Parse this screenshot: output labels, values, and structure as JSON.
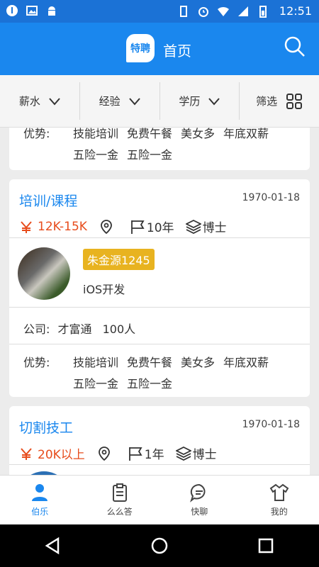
{
  "status_bar": {
    "time": "12:51"
  },
  "app_bar": {
    "logo_text": "特聘",
    "title": "首页"
  },
  "filters": [
    {
      "label": "薪水"
    },
    {
      "label": "经验"
    },
    {
      "label": "学历"
    },
    {
      "label": "筛选"
    }
  ],
  "partial_card": {
    "adv_label": "优势:",
    "adv_values": [
      "技能培训",
      "免费午餐",
      "美女多",
      "年底双薪",
      "五险一金",
      "五险一金"
    ]
  },
  "jobs": [
    {
      "title": "培训/课程",
      "date": "1970-01-18",
      "salary": "12K-15K",
      "experience": "10年",
      "education": "博士",
      "poster_name": "朱金源1245",
      "poster_job": "iOS开发",
      "company_label": "公司:",
      "company_name": "才富通",
      "company_size": "100人",
      "adv_label": "优势:",
      "adv_values": [
        "技能培训",
        "免费午餐",
        "美女多",
        "年底双薪",
        "五险一金",
        "五险一金"
      ]
    },
    {
      "title": "切割技工",
      "date": "1970-01-18",
      "salary": "20K以上",
      "experience": "1年",
      "education": "博士"
    }
  ],
  "tabs": [
    {
      "label": "伯乐",
      "active": true
    },
    {
      "label": "么么答",
      "active": false
    },
    {
      "label": "快聊",
      "active": false
    },
    {
      "label": "我的",
      "active": false
    }
  ],
  "colors": {
    "primary": "#1a87ee",
    "salary": "#e74c1c",
    "badge": "#e8b320"
  }
}
